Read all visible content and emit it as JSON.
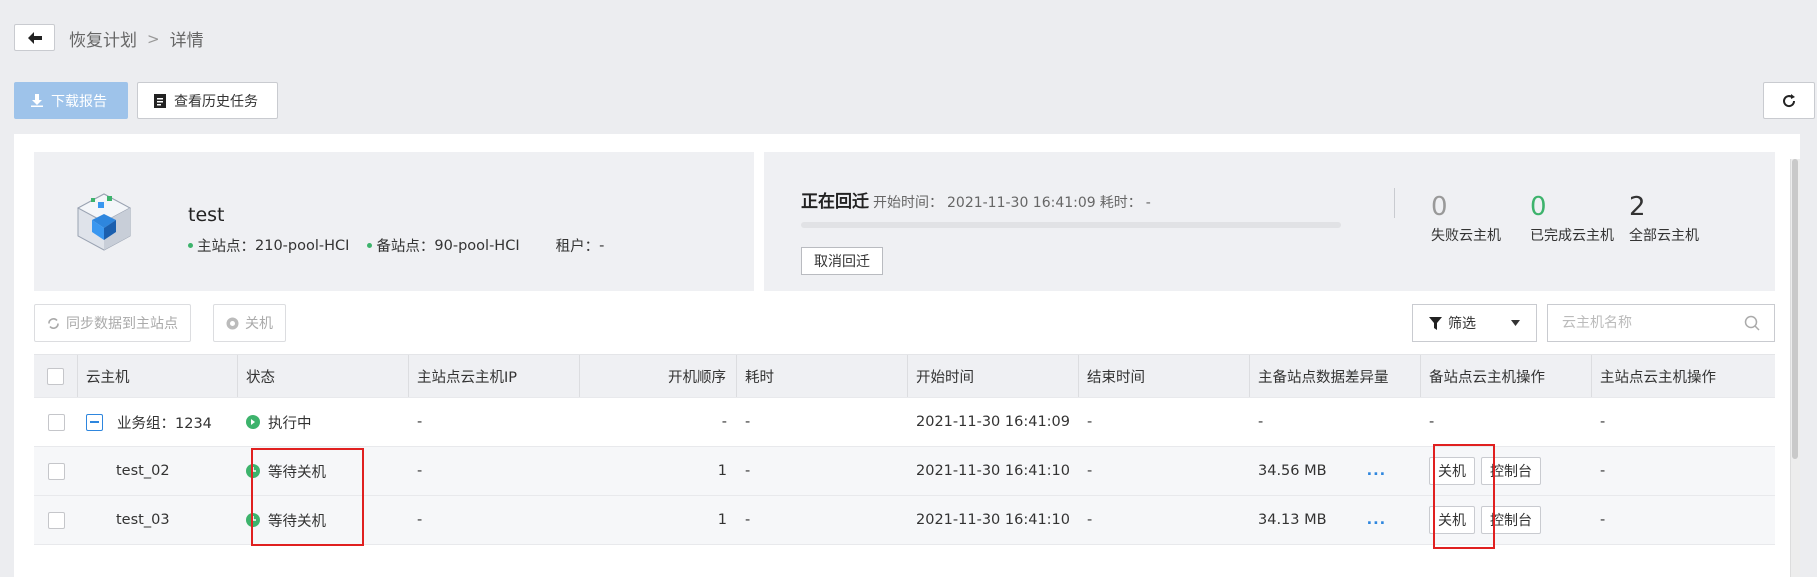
{
  "breadcrumb": {
    "parent": "恢复计划",
    "separator": ">",
    "current": "详情"
  },
  "toolbar": {
    "download_label": "下载报告",
    "history_label": "查看历史任务"
  },
  "vm_info": {
    "name": "test",
    "primary_site_label": "主站点：",
    "primary_site": "210-pool-HCI",
    "backup_site_label": "备站点：",
    "backup_site": "90-pool-HCI",
    "tenant_label": "租户：",
    "tenant": "-"
  },
  "task_status": {
    "title": "正在回迁",
    "start_label": "开始时间：",
    "start_time": "2021-11-30 16:41:09",
    "elapsed_label": "耗时：",
    "elapsed": "-",
    "cancel_label": "取消回迁",
    "progress_percent": 0
  },
  "stats": [
    {
      "value": "0",
      "label": "失败云主机",
      "color": "#999999"
    },
    {
      "value": "0",
      "label": "已完成云主机",
      "color": "#3db36c"
    },
    {
      "value": "2",
      "label": "全部云主机",
      "color": "#333333"
    }
  ],
  "actions": {
    "sync_label": "同步数据到主站点",
    "shutdown_label": "关机"
  },
  "filter": {
    "label": "筛选"
  },
  "search": {
    "placeholder": "云主机名称"
  },
  "table": {
    "columns": [
      "云主机",
      "状态",
      "主站点云主机IP",
      "开机顺序",
      "耗时",
      "开始时间",
      "结束时间",
      "主备站点数据差异量",
      "备站点云主机操作",
      "主站点云主机操作"
    ],
    "group_row": {
      "name": "业务组：1234",
      "status": "执行中",
      "ip": "-",
      "order": "-",
      "elapsed": "-",
      "start": "2021-11-30 16:41:09",
      "end": "-",
      "diff": "-",
      "backup_ops": "-",
      "primary_ops": "-"
    },
    "rows": [
      {
        "name": "test_02",
        "status": "等待关机",
        "ip": "-",
        "order": "1",
        "elapsed": "-",
        "start": "2021-11-30 16:41:10",
        "end": "-",
        "diff": "34.56 MB",
        "more": "...",
        "op_shutdown": "关机",
        "op_console": "控制台",
        "primary_ops": "-"
      },
      {
        "name": "test_03",
        "status": "等待关机",
        "ip": "-",
        "order": "1",
        "elapsed": "-",
        "start": "2021-11-30 16:41:10",
        "end": "-",
        "diff": "34.13 MB",
        "more": "...",
        "op_shutdown": "关机",
        "op_console": "控制台",
        "primary_ops": "-"
      }
    ]
  },
  "colors": {
    "accent": "#2e86de",
    "success": "#3db36c",
    "highlight": "#e02020",
    "download_bg": "#9ec3ea"
  }
}
